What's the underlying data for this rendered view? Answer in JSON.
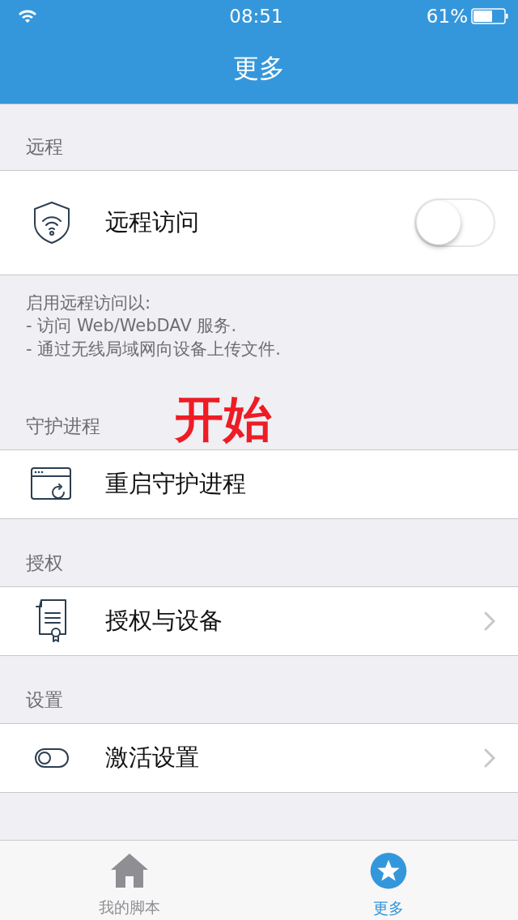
{
  "status_bar": {
    "time": "08:51",
    "battery": "61%"
  },
  "nav_bar": {
    "title": "更多"
  },
  "sections": [
    {
      "header": "远程",
      "rows": [
        {
          "kind": "toggle",
          "label": "远程访问",
          "on": false
        }
      ],
      "footer": [
        "启用远程访问以:",
        "- 访问 Web/WebDAV 服务.",
        "- 通过无线局域网向设备上传文件."
      ]
    },
    {
      "header": "守护进程",
      "annotation": "开始",
      "rows": [
        {
          "kind": "action",
          "label": "重启守护进程"
        }
      ]
    },
    {
      "header": "授权",
      "rows": [
        {
          "kind": "link",
          "label": "授权与设备"
        }
      ]
    },
    {
      "header": "设置",
      "rows": [
        {
          "kind": "link",
          "label": "激活设置"
        }
      ]
    }
  ],
  "tab_bar": [
    {
      "label": "我的脚本",
      "selected": false
    },
    {
      "label": "更多",
      "selected": true
    }
  ]
}
